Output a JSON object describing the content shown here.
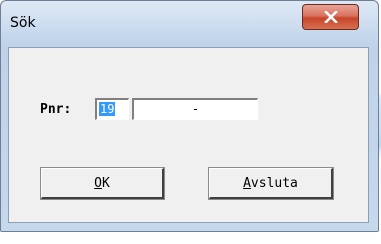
{
  "window": {
    "title": "Sök",
    "close_icon": "close-x-icon",
    "close_color": "#c8452c"
  },
  "form": {
    "pnr_label": "Pnr:",
    "pnr_prefix_value": "19",
    "pnr_rest_value": "-"
  },
  "buttons": {
    "ok_mnemonic": "O",
    "ok_rest": "K",
    "exit_mnemonic": "A",
    "exit_rest": "vsluta"
  }
}
